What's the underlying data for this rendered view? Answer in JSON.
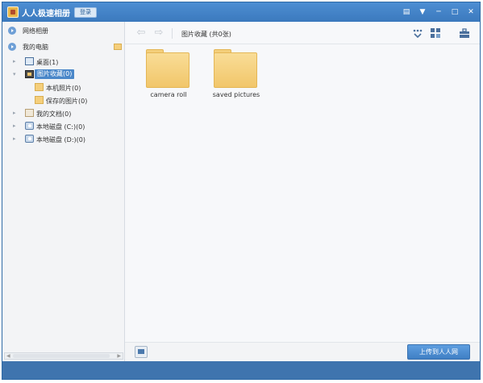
{
  "titlebar": {
    "title": "人人极速相册",
    "login_label": "登录",
    "icons": [
      "message-icon",
      "dropdown-icon",
      "minimize-icon",
      "maximize-icon",
      "close-icon"
    ]
  },
  "sidebar": {
    "online_album": "网络相册",
    "my_computer": "我的电脑",
    "items": [
      {
        "label": "桌面(1)",
        "icon": "desktop-icon"
      },
      {
        "label": "图片收藏(0)",
        "icon": "photo-collection-icon",
        "selected": true
      },
      {
        "label": "本机照片(0)",
        "icon": "folder-icon"
      },
      {
        "label": "保存的图片(0)",
        "icon": "folder-icon"
      },
      {
        "label": "我的文档(0)",
        "icon": "documents-icon"
      },
      {
        "label": "本地磁盘 (C:)(0)",
        "icon": "disk-icon"
      },
      {
        "label": "本地磁盘 (D:)(0)",
        "icon": "disk-icon"
      }
    ]
  },
  "toolbar": {
    "breadcrumb": "图片收藏 (共0张)",
    "icons": [
      "back-icon",
      "forward-icon",
      "view-options-icon",
      "grid-view-icon",
      "toolbox-icon"
    ]
  },
  "folders": [
    {
      "label": "camera roll"
    },
    {
      "label": "saved pictures"
    }
  ],
  "bottom": {
    "upload_label": "上传到人人网"
  },
  "colors": {
    "titlebar": "#3b79bd",
    "selection": "#4a87c9",
    "folder": "#f1c66a",
    "status_strip": "#3f74ae"
  }
}
